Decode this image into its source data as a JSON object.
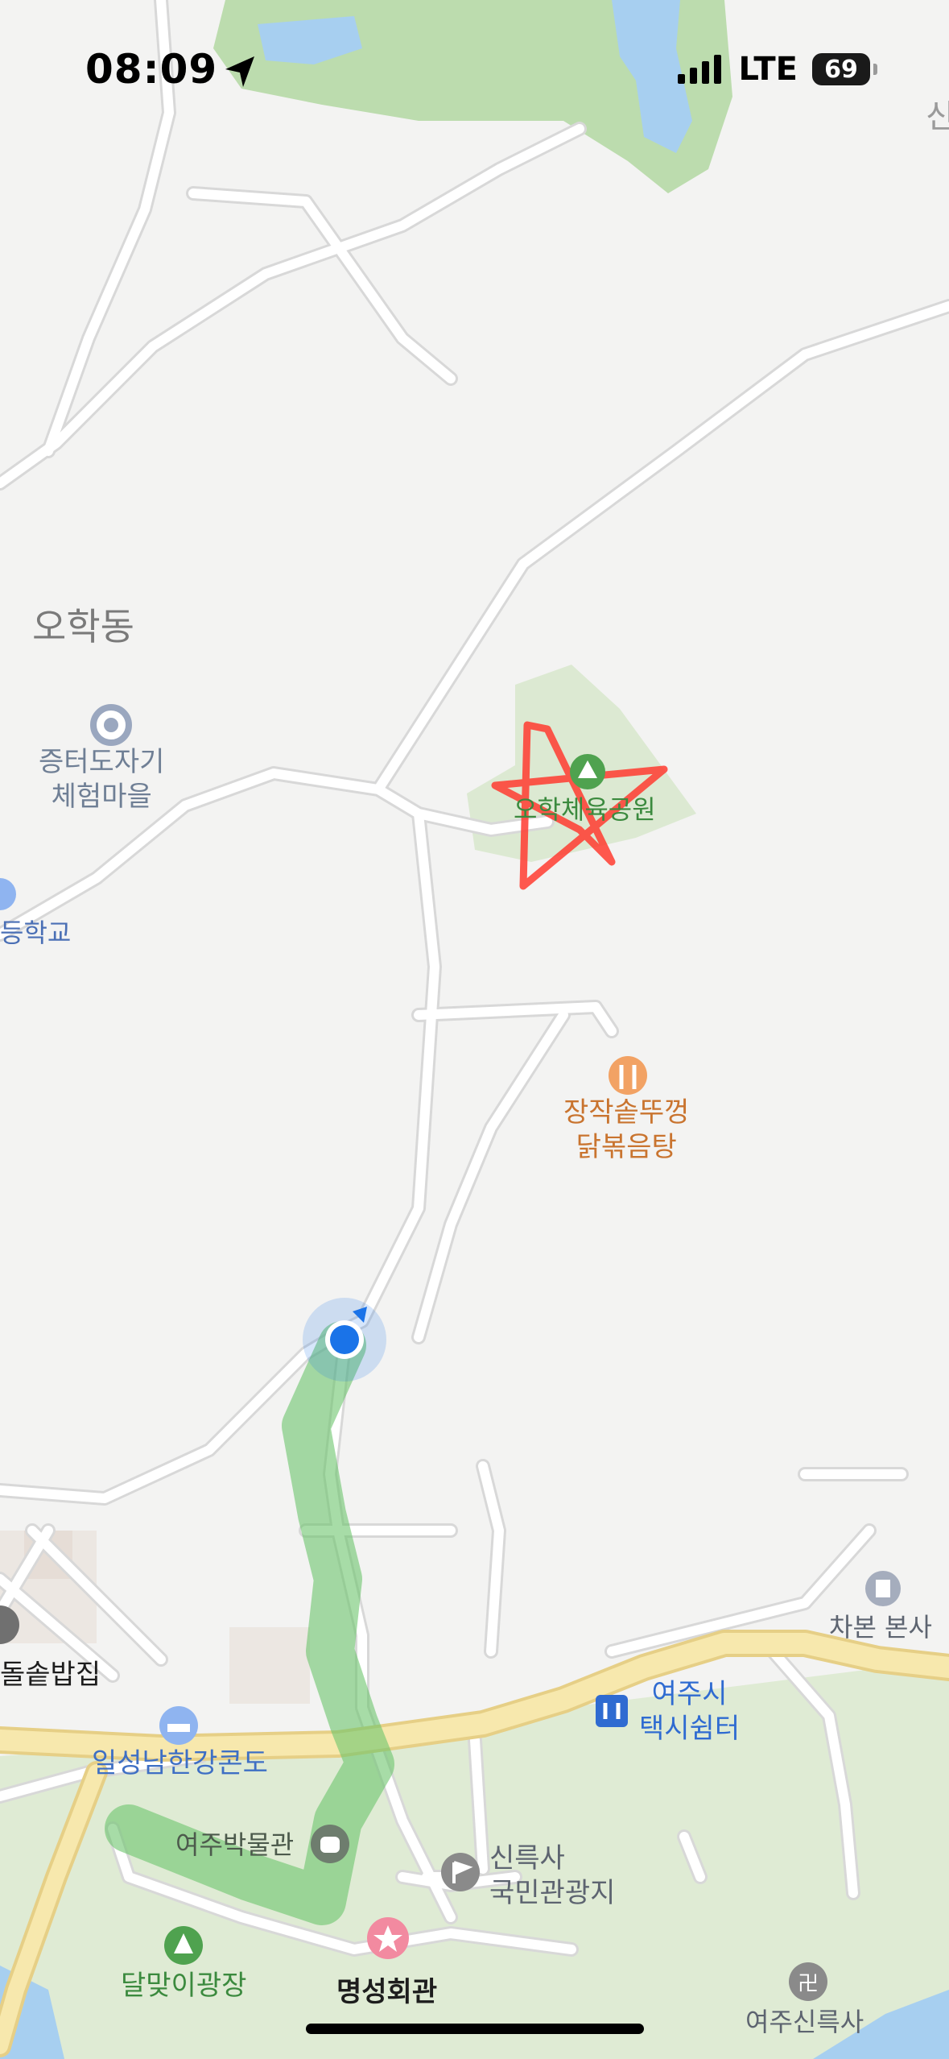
{
  "status_bar": {
    "time": "08:09",
    "network": "LTE",
    "battery": "69",
    "location_icon": "location-arrow-icon",
    "signal_icon": "cellular-signal-icon"
  },
  "map": {
    "district_label": "오학동",
    "edge_label_top_right": "신",
    "places": [
      {
        "id": "jeungteo",
        "line1": "증터도자기",
        "line2": "체험마을",
        "icon": "landmark-ring-icon",
        "color": "#6f7f95"
      },
      {
        "id": "school",
        "line1": "등학교",
        "line2": "",
        "icon": "school-icon",
        "color": "#4a6fb5"
      },
      {
        "id": "ohak-park",
        "line1": "오학체육공원",
        "line2": "",
        "icon": "park-icon",
        "color": "#3b8a3e"
      },
      {
        "id": "restaurant",
        "line1": "장작솥뚜껑",
        "line2": "닭볶음탕",
        "icon": "fork-knife-icon",
        "color": "#c9742f"
      },
      {
        "id": "chabon",
        "line1": "차본 본사",
        "line2": "",
        "icon": "office-building-icon",
        "color": "#5d6470"
      },
      {
        "id": "taxi",
        "line1": "여주시",
        "line2": "택시쉼터",
        "icon": "taxi-stand-icon",
        "color": "#2f6bd1"
      },
      {
        "id": "condo",
        "line1": "일성남한강콘도",
        "line2": "",
        "icon": "bed-icon",
        "color": "#3e6fc4"
      },
      {
        "id": "sotbap",
        "line1": "돌솥밥집",
        "line2": "",
        "icon": "pin-icon",
        "color": "#1d1d1d"
      },
      {
        "id": "museum",
        "line1": "여주박물관",
        "line2": "",
        "icon": "museum-icon",
        "color": "#4c5a4c"
      },
      {
        "id": "silleuksa-area",
        "line1": "신륵사",
        "line2": "국민관광지",
        "icon": "flag-icon",
        "color": "#5d6470"
      },
      {
        "id": "dalmaji",
        "line1": "달맞이광장",
        "line2": "",
        "icon": "tree-icon",
        "color": "#3b8a3e"
      },
      {
        "id": "myeongseong",
        "line1": "명성회관",
        "line2": "",
        "icon": "star-icon",
        "color": "#1d1d1d"
      },
      {
        "id": "silleuksa",
        "line1": "여주신륵사",
        "line2": "",
        "icon": "temple-icon",
        "color": "#5d6470"
      }
    ]
  },
  "colors": {
    "background": "#f3f3f2",
    "road": "#ffffff",
    "road_edge": "#d9d9d9",
    "highway": "#f4e4a4",
    "park": "#dce9d2",
    "forest": "#b6d9a6",
    "water": "#a7cff0",
    "route_highlight": "#6cc56c",
    "user_dot": "#1a73e8",
    "annotation": "#ff3b30"
  }
}
